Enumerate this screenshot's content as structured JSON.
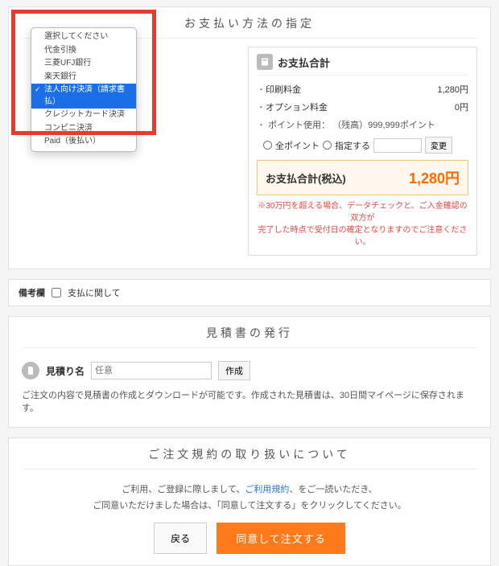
{
  "payment_panel": {
    "title": "お支払い方法の指定",
    "dropdown_options": [
      "選択してください",
      "代金引換",
      "三菱UFJ銀行",
      "楽天銀行",
      "法人向け決済（請求書払）",
      "クレジットカード決済",
      "コンビニ決済",
      "Paid（後払い）"
    ],
    "dropdown_selected_index": 4
  },
  "total_box": {
    "heading": "お支払合計",
    "rows": [
      {
        "label": "印刷料金",
        "value": "1,280円"
      },
      {
        "label": "オプション料金",
        "value": "0円"
      }
    ],
    "points_label": "ポイント使用：",
    "points_balance": "（残高）999,999ポイント",
    "radio_all": "全ポイント",
    "radio_specify": "指定する",
    "change_btn": "変更",
    "grand_label": "お支払合計(税込)",
    "grand_value": "1,280円",
    "note_line1": "※30万円を超える場合、データチェックと、ご入金確認の双方が",
    "note_line2": "完了した時点で受付日の確定となりますのでご注意ください。"
  },
  "remarks": {
    "label": "備考欄",
    "checkbox_label": "支払に関して"
  },
  "quote": {
    "title": "見積書の発行",
    "name_label": "見積り名",
    "placeholder": "任意",
    "make_btn": "作成",
    "note": "ご注文の内容で見積書の作成とダウンロードが可能です。作成された見積書は、30日間マイページに保存されます。"
  },
  "terms": {
    "title": "ご注文規約の取り扱いについて",
    "line1a": "ご利用、ご登録に際しまして、",
    "link": "ご利用規約",
    "line1b": "、をご一読いただき、",
    "line2": "ご同意いただけました場合は、「同意して注文する」をクリックしてください。",
    "back_btn": "戻る",
    "agree_btn": "同意して注文する"
  }
}
